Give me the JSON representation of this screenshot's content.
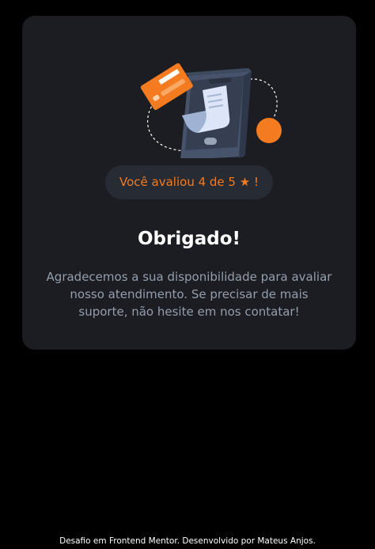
{
  "card": {
    "rating_text": "Você avaliou 4 de 5 ★ !",
    "title": "Obrigado!",
    "message": "Agradecemos a sua disponibilidade para avaliar nosso atendimento. Se precisar de mais suporte, não hesite em nos contatar!"
  },
  "footer": {
    "attribution": "Desafio em Frontend Mentor. Desenvolvido por Mateus Anjos."
  },
  "colors": {
    "page_background": "#000000",
    "card_background": "#1b1d22",
    "pill_background": "#272b33",
    "accent_orange": "#f47b20",
    "body_text": "#959eac",
    "heading_text": "#ffffff"
  },
  "icons": {
    "illustration": "payment-phone-illustration",
    "credit_card": "credit-card-icon",
    "phone": "smartphone-icon",
    "receipt": "receipt-icon",
    "coin": "coin-icon",
    "star": "star-glyph"
  }
}
